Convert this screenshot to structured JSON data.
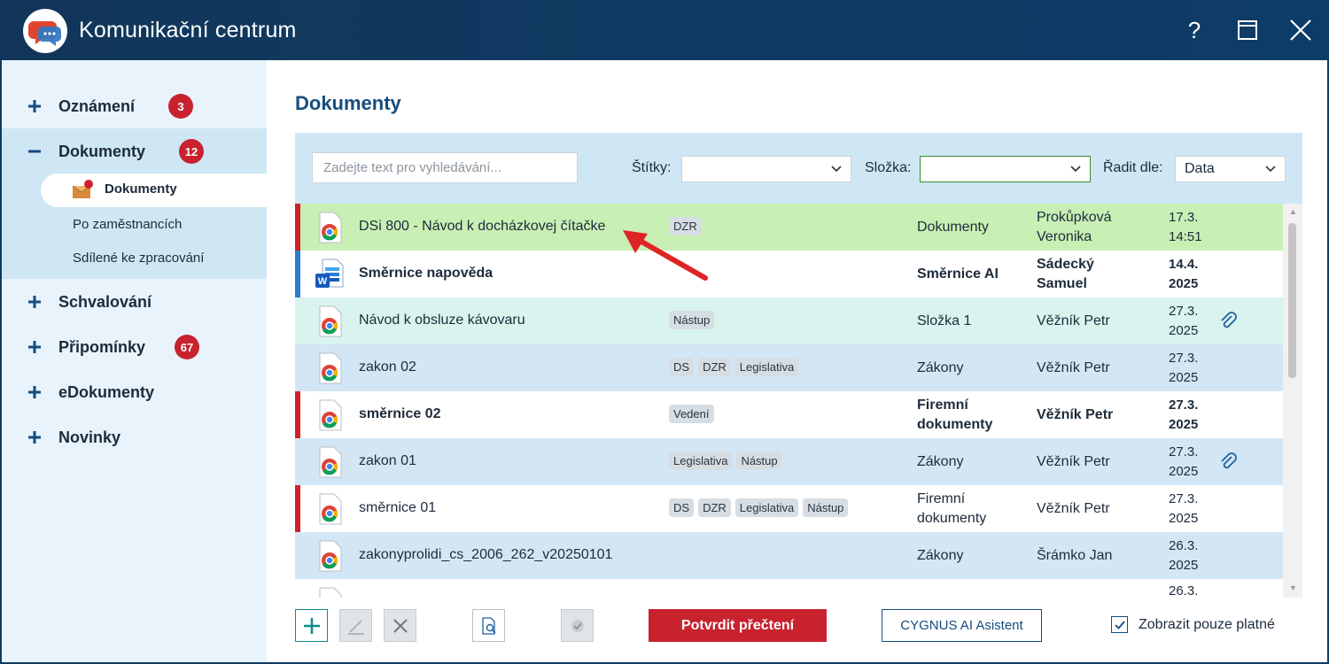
{
  "window": {
    "title": "Komunikační centrum",
    "help_label": "?"
  },
  "sidebar": {
    "items": [
      {
        "label": "Oznámení",
        "badge": "3",
        "expanded": false
      },
      {
        "label": "Dokumenty",
        "badge": "12",
        "expanded": true
      },
      {
        "label": "Schvalování",
        "badge": "",
        "expanded": false
      },
      {
        "label": "Připomínky",
        "badge": "67",
        "expanded": false
      },
      {
        "label": "eDokumenty",
        "badge": "",
        "expanded": false
      },
      {
        "label": "Novinky",
        "badge": "",
        "expanded": false
      }
    ],
    "subitems": [
      {
        "label": "Dokumenty",
        "active": true
      },
      {
        "label": "Po zaměstnancích",
        "active": false
      },
      {
        "label": "Sdílené ke zpracování",
        "active": false
      }
    ]
  },
  "main": {
    "title": "Dokumenty",
    "filters": {
      "search_placeholder": "Zadejte text pro vyhledávání...",
      "tags_label": "Štítky:",
      "tags_value": "",
      "folder_label": "Složka:",
      "folder_value": "",
      "sort_label": "Řadit dle:",
      "sort_value": "Data"
    },
    "documents": [
      {
        "name": "DSi 800 - Návod k docházkovej čítačke",
        "tags": [
          "DZR"
        ],
        "folder": "Dokumenty",
        "author": "Prokůpková Veronika",
        "date": "17.3. 14:51",
        "unread": false,
        "attachment": false
      },
      {
        "name": "Směrnice napověda",
        "tags": [],
        "folder": "Směrnice AI",
        "author": "Sádecký Samuel",
        "date": "14.4. 2025",
        "unread": true,
        "attachment": false
      },
      {
        "name": "Návod k obsluze kávovaru",
        "tags": [
          "Nástup"
        ],
        "folder": "Složka 1",
        "author": "Věžník Petr",
        "date": "27.3. 2025",
        "unread": false,
        "attachment": true
      },
      {
        "name": "zakon 02",
        "tags": [
          "DS",
          "DZR",
          "Legislativa"
        ],
        "folder": "Zákony",
        "author": "Věžník Petr",
        "date": "27.3. 2025",
        "unread": false,
        "attachment": false
      },
      {
        "name": "směrnice 02",
        "tags": [
          "Vedení"
        ],
        "folder": "Firemní dokumenty",
        "author": "Věžník Petr",
        "date": "27.3. 2025",
        "unread": true,
        "attachment": false
      },
      {
        "name": "zakon 01",
        "tags": [
          "Legislativa",
          "Nástup"
        ],
        "folder": "Zákony",
        "author": "Věžník Petr",
        "date": "27.3. 2025",
        "unread": false,
        "attachment": true
      },
      {
        "name": "směrnice 01",
        "tags": [
          "DS",
          "DZR",
          "Legislativa",
          "Nástup"
        ],
        "folder": "Firemní dokumenty",
        "author": "Věžník Petr",
        "date": "27.3. 2025",
        "unread": false,
        "attachment": false
      },
      {
        "name": "zakonyprolidi_cs_2006_262_v20250101",
        "tags": [],
        "folder": "Zákony",
        "author": "Šrámko Jan",
        "date": "26.3. 2025",
        "unread": false,
        "attachment": false
      },
      {
        "name": "",
        "tags": [],
        "folder": "",
        "author": "",
        "date": "26.3.",
        "unread": false,
        "attachment": false
      }
    ]
  },
  "toolbar": {
    "add_icon": "plus-icon",
    "edit_icon": "pencil-icon",
    "delete_icon": "x-icon",
    "preview_icon": "document-preview-icon",
    "check_icon": "checkmark-icon",
    "confirm_label": "Potvrdit přečtení",
    "ai_label": "CYGNUS AI Asistent",
    "only_valid_label": "Zobrazit pouze platné",
    "only_valid_checked": true
  },
  "colors": {
    "titlebar": "#12365a",
    "accent_blue": "#164c7e",
    "badge_red": "#c8222f",
    "row_selected": "#c8efb4",
    "row_hover": "#d9f3ee",
    "row_alt": "#d3e6f5",
    "row_unread_bar": "#d0202c",
    "row_word_bar": "#2b7cd3"
  }
}
